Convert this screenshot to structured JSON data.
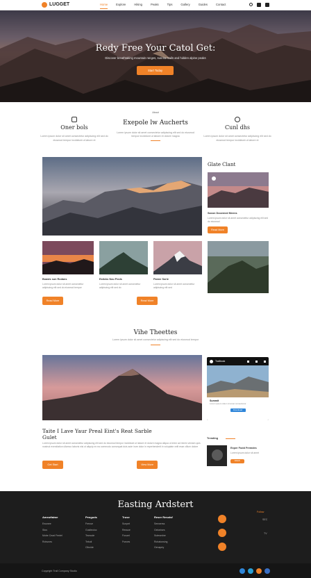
{
  "nav": {
    "brand": "LUGGET",
    "items": [
      "Home",
      "Explore",
      "Hiking",
      "Peaks",
      "Tips",
      "Gallery",
      "Guides",
      "Contact"
    ],
    "active_index": 0
  },
  "hero": {
    "title": "Redy Free Your Catol Get:",
    "subtitle": "Discover breathtaking mountain ranges, sunrise trails and hidden alpine peaks",
    "button": "Start Today"
  },
  "intro": {
    "caption": "About",
    "features": [
      {
        "title": "Oner bols",
        "text": "Lorem ipsum dolor sit amet consectetur adipiscing elit sed do eiusmod tempor incididunt ut labore et"
      },
      {
        "title": "Exepole lw Aucherts",
        "text": "Lorem ipsum dolor sit amet consectetur adipiscing elit sed do eiusmod tempor incididunt ut labore et dolore magna"
      },
      {
        "title": "Cunl dhs",
        "text": "Lorem ipsum dolor sit amet consectetur adipiscing elit sed do eiusmod tempor incididunt ut labore et"
      }
    ]
  },
  "gallery": {
    "side_title": "Glate Clant",
    "side_card_title": "Saxon Dooemed Meens",
    "side_card_text": "Lorem ipsum dolor sit amet consectetur adipiscing elit sed do eiusmod",
    "side_button": "Read More",
    "cards": [
      {
        "title": "Boasts sun Rodans",
        "text": "Lorem ipsum dolor sit amet consectetur adipiscing elit sed do eiusmod tempor"
      },
      {
        "title": "Esticks Nou Peols",
        "text": "Lorem ipsum dolor sit amet consectetur adipiscing elit sed do"
      },
      {
        "title": "Panne Sorie",
        "text": "Lorem ipsum dolor sit amet consectetur adipiscing elit sed"
      }
    ],
    "button_left": "Read More",
    "button_mid": "Read More"
  },
  "featured": {
    "title": "Vihe Theettes",
    "subtitle": "Lorem ipsum dolor sit amet consectetur adipiscing elit sed do eiusmod tempor",
    "headline": "Taite I Lave Yaur Preal Eint's Reat Sarble Gulet",
    "text": "Lorem ipsum dolor sit amet consectetur adipiscing elit sed do eiusmod tempor incididunt ut labore et dolore magna aliqua ut enim ad minim veniam quis nostrud exercitation ullamco laboris nisi ut aliquip ex ea commodo consequat duis aute irure dolor in reprehenderit in voluptate velit esse cillum dolore",
    "button_left": "Get Start",
    "button_mid": "View More",
    "phone_title": "Trailbook",
    "phone_card_title": "Summit",
    "phone_card_text": "Lorem ipsum dolor sit amet consectetur",
    "phone_button": "Download",
    "mini_head": "Trending",
    "mini_title": "Exper Fodd Fremdes",
    "mini_text": "Lorem ipsum dolor sit amet",
    "mini_button": "Watch"
  },
  "footer": {
    "title": "Easting Ardstert",
    "columns": [
      {
        "head": "Ameutfaiwe",
        "items": [
          "Ewonee",
          "Stos",
          "Mobe Cead Fentel",
          "Rohunes"
        ]
      },
      {
        "head": "Peoguds",
        "items": [
          "Frenue",
          "Gusiteoloc",
          "Tecnode",
          "Tebuti",
          "Clbuide"
        ]
      },
      {
        "head": "Truse",
        "items": [
          "Sunpet",
          "Ressoe",
          "Fosuet",
          "Fseces"
        ]
      },
      {
        "head": "Reser Resolsf",
        "items": [
          "Senwerss",
          "Gelonises",
          "Sutesedne",
          "Rchatonsing",
          "Genapey"
        ]
      }
    ],
    "right_label": "Follow",
    "right_items": [
      "SEC",
      "TV"
    ],
    "copyright": "Copyright Trail Company Studio",
    "accent": "#f08228"
  }
}
